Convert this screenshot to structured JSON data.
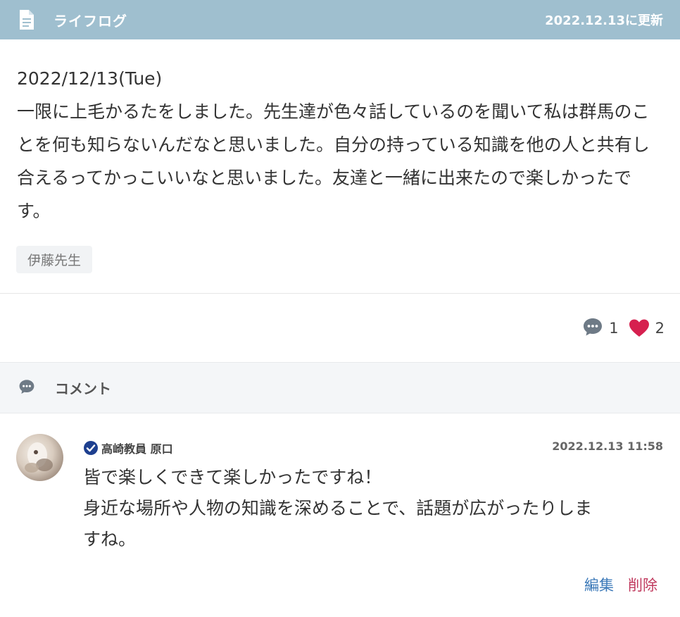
{
  "header": {
    "title": "ライフログ",
    "updated": "2022.12.13に更新",
    "icon": "document-icon"
  },
  "post": {
    "date": "2022/12/13(Tue)",
    "body": "一限に上毛かるたをしました。先生達が色々話しているのを聞いて私は群馬のことを何も知らないんだなと思いました。自分の持っている知識を他の人と共有し合えるってかっこいいなと思いました。友達と一緒に出来たので楽しかったです。",
    "tag": "伊藤先生"
  },
  "reactions": {
    "comment_count": "1",
    "like_count": "2",
    "comment_icon": "comment-bubble-icon",
    "like_icon": "heart-icon",
    "like_color": "#d6204f"
  },
  "comments_section": {
    "label": "コメント",
    "icon": "comment-bubble-icon"
  },
  "comment": {
    "author": "高崎教員 原口",
    "verified_icon": "verified-check-icon",
    "timestamp": "2022.12.13 11:58",
    "lines": [
      "皆で楽しくできて楽しかったですね！",
      "身近な場所や人物の知識を深めることで、話題が広がったりしま",
      "すね。"
    ],
    "edit_label": "編集",
    "delete_label": "削除"
  },
  "colors": {
    "header_bg": "#9fbfcf",
    "edit": "#3a78b8",
    "delete": "#c03a5e",
    "verified": "#1d3f8f"
  }
}
